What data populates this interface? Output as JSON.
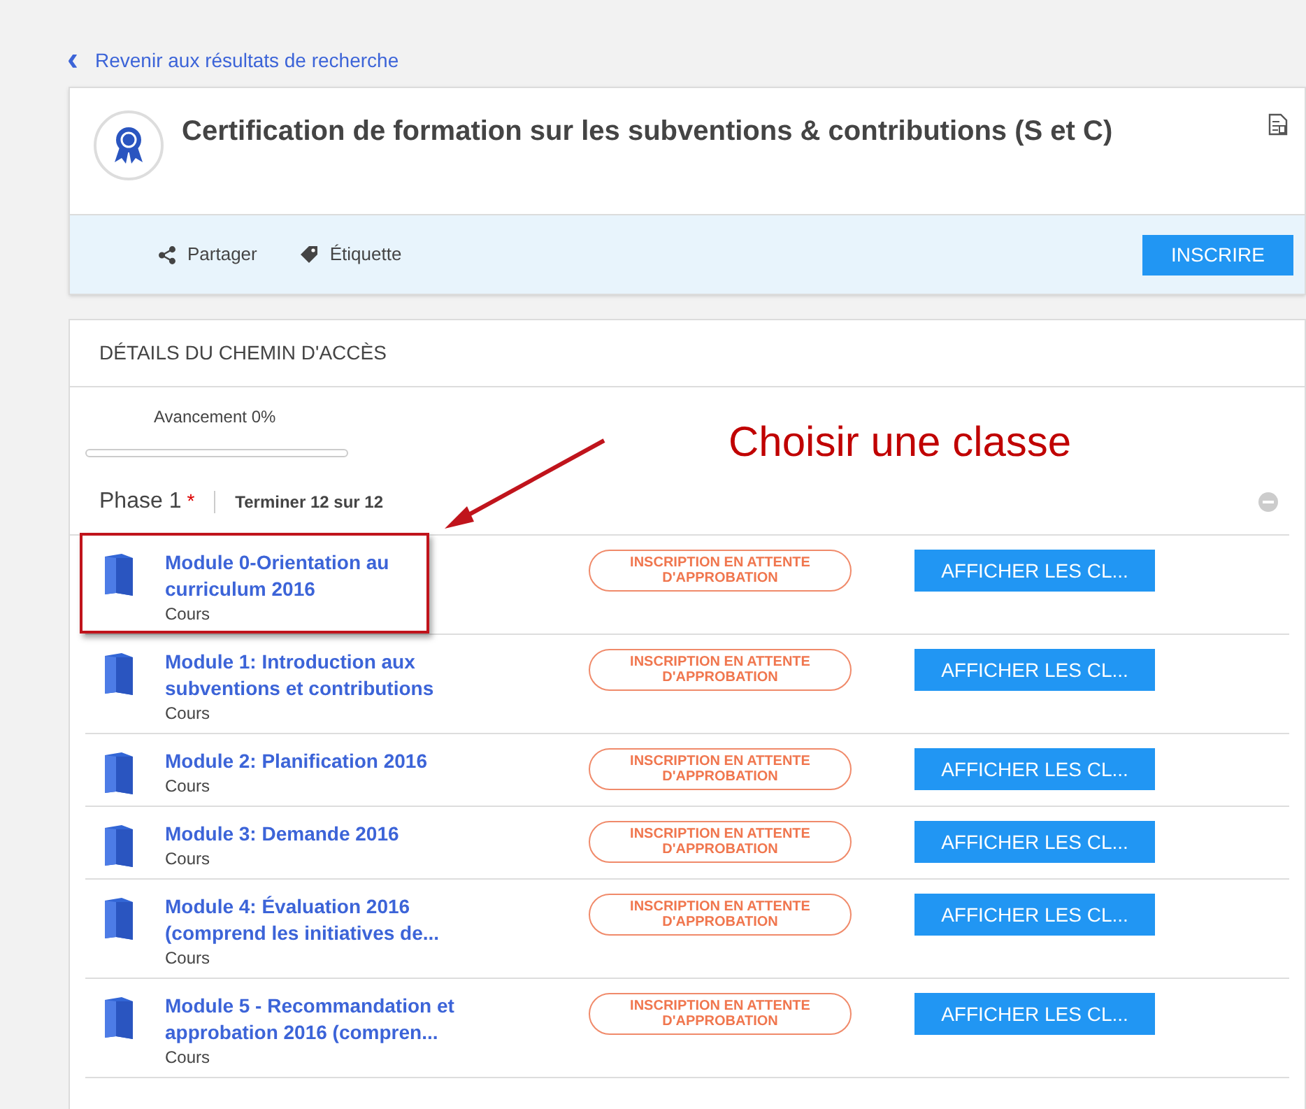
{
  "back_link": {
    "icon": "‹",
    "label": "Revenir aux résultats de recherche"
  },
  "header": {
    "title": "Certification de formation sur les subventions & contributions (S et C)"
  },
  "actions": [
    {
      "kind": "share",
      "label": "Partager"
    },
    {
      "kind": "tag",
      "label": "Étiquette"
    }
  ],
  "enroll_button": "INSCRIRE",
  "details": {
    "heading": "DÉTAILS DU CHEMIN D'ACCÈS",
    "progress": {
      "label": "Avancement 0%",
      "level": 0
    },
    "phase": {
      "name": "Phase 1",
      "required_mark": "*",
      "completion": "Terminer 12 sur 12",
      "expanded": true
    },
    "modules": [
      {
        "title": "Module 0-Orientation au curriculum 2016",
        "type": "Cours",
        "status": "INSCRIPTION EN ATTENTE D'APPROBATION",
        "button": "AFFICHER LES CL...",
        "highlighted": true
      },
      {
        "title": "Module 1: Introduction aux subventions et contributions",
        "type": "Cours",
        "status": "INSCRIPTION EN ATTENTE D'APPROBATION",
        "button": "AFFICHER LES CL...",
        "highlighted": false
      },
      {
        "title": "Module 2: Planification 2016",
        "type": "Cours",
        "status": "INSCRIPTION EN ATTENTE D'APPROBATION",
        "button": "AFFICHER LES CL...",
        "highlighted": false
      },
      {
        "title": "Module 3: Demande 2016",
        "type": "Cours",
        "status": "INSCRIPTION EN ATTENTE D'APPROBATION",
        "button": "AFFICHER LES CL...",
        "highlighted": false
      },
      {
        "title": "Module 4: Évaluation 2016 (comprend les initiatives de...",
        "type": "Cours",
        "status": "INSCRIPTION EN ATTENTE D'APPROBATION",
        "button": "AFFICHER LES CL...",
        "highlighted": false
      },
      {
        "title": "Module 5 - Recommandation et approbation 2016 (compren...",
        "type": "Cours",
        "status": "INSCRIPTION EN ATTENTE D'APPROBATION",
        "button": "AFFICHER LES CL...",
        "highlighted": false
      }
    ]
  },
  "annotation": {
    "text": "Choisir une classe"
  }
}
